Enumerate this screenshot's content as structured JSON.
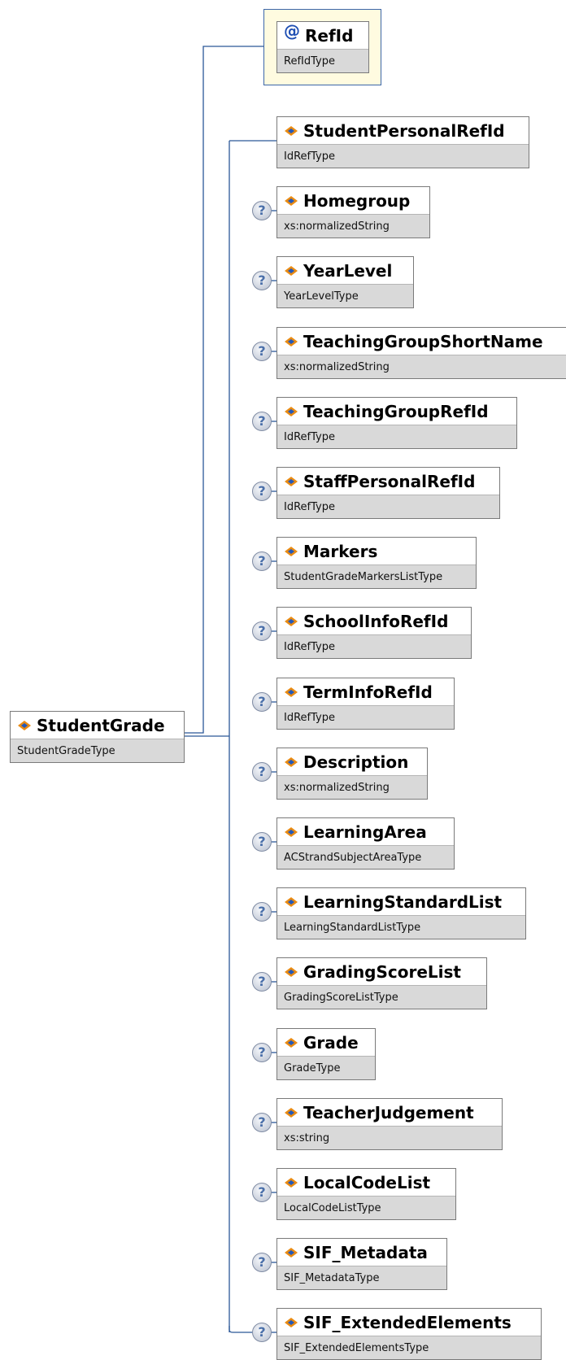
{
  "root": {
    "name": "StudentGrade",
    "type": "StudentGradeType"
  },
  "attribute": {
    "name": "RefId",
    "type": "RefIdType"
  },
  "optional_marker": "?",
  "colors": {
    "connector": "#2b5797",
    "attr_bg": "#fffbe0",
    "type_bg": "#d9d9d9",
    "icon_orange": "#e98b13",
    "icon_blue": "#2459b9"
  },
  "elements": [
    {
      "name": "StudentPersonalRefId",
      "type": "IdRefType",
      "optional": false
    },
    {
      "name": "Homegroup",
      "type": "xs:normalizedString",
      "optional": true
    },
    {
      "name": "YearLevel",
      "type": "YearLevelType",
      "optional": true
    },
    {
      "name": "TeachingGroupShortName",
      "type": "xs:normalizedString",
      "optional": true
    },
    {
      "name": "TeachingGroupRefId",
      "type": "IdRefType",
      "optional": true
    },
    {
      "name": "StaffPersonalRefId",
      "type": "IdRefType",
      "optional": true
    },
    {
      "name": "Markers",
      "type": "StudentGradeMarkersListType",
      "optional": true
    },
    {
      "name": "SchoolInfoRefId",
      "type": "IdRefType",
      "optional": true
    },
    {
      "name": "TermInfoRefId",
      "type": "IdRefType",
      "optional": true
    },
    {
      "name": "Description",
      "type": "xs:normalizedString",
      "optional": true
    },
    {
      "name": "LearningArea",
      "type": "ACStrandSubjectAreaType",
      "optional": true
    },
    {
      "name": "LearningStandardList",
      "type": "LearningStandardListType",
      "optional": true
    },
    {
      "name": "GradingScoreList",
      "type": "GradingScoreListType",
      "optional": true
    },
    {
      "name": "Grade",
      "type": "GradeType",
      "optional": true
    },
    {
      "name": "TeacherJudgement",
      "type": "xs:string",
      "optional": true
    },
    {
      "name": "LocalCodeList",
      "type": "LocalCodeListType",
      "optional": true
    },
    {
      "name": "SIF_Metadata",
      "type": "SIF_MetadataType",
      "optional": true
    },
    {
      "name": "SIF_ExtendedElements",
      "type": "SIF_ExtendedElementsType",
      "optional": true
    }
  ]
}
